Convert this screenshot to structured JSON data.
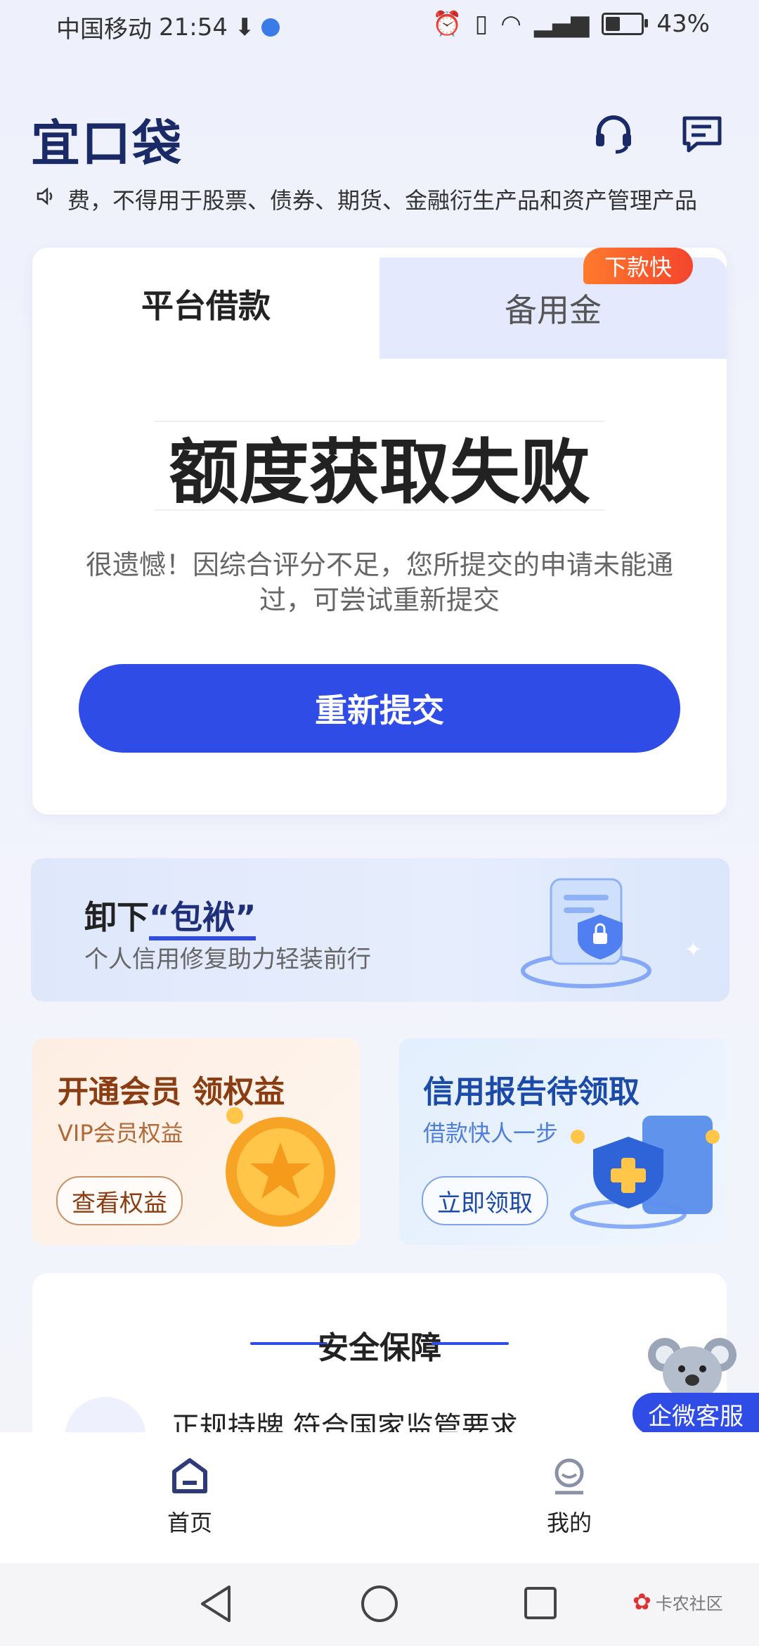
{
  "status_bar": {
    "carrier": "中国移动",
    "time": "21:54",
    "battery": "43%",
    "battery_level": 0.43
  },
  "header": {
    "logo": "宜口袋",
    "icons": [
      "headset-icon",
      "message-icon"
    ]
  },
  "marquee": {
    "icon": "speaker-icon",
    "text": "费，不得用于股票、债券、期货、金融衍生产品和资产管理产品"
  },
  "loan_card": {
    "tabs": [
      {
        "label": "平台借款",
        "active": true
      },
      {
        "label": "备用金",
        "active": false
      }
    ],
    "badge": "下款快",
    "status_title": "额度获取失败",
    "status_desc": "很遗憾！因综合评分不足，您所提交的申请未能通过，可尝试重新提交",
    "resubmit_label": "重新提交"
  },
  "banner": {
    "title_prefix": "卸下",
    "title_highlight": "“包袱”",
    "subtitle": "个人信用修复助力轻装前行"
  },
  "promos": [
    {
      "title": "开通会员 领权益",
      "subtitle": "VIP会员权益",
      "button": "查看权益"
    },
    {
      "title": "信用报告待领取",
      "subtitle": "借款快人一步",
      "button": "立即领取"
    }
  ],
  "security": {
    "title": "安全保障",
    "item": "正规持牌 符合国家监管要求"
  },
  "float_service": "企微客服",
  "bottom_nav": [
    {
      "label": "首页",
      "icon": "home-icon",
      "active": true
    },
    {
      "label": "我的",
      "icon": "profile-icon",
      "active": false
    }
  ],
  "watermark": "卡农社区",
  "colors": {
    "primary": "#2f4de6",
    "badge": "#f4452d",
    "promo_left_text": "#8a3d12",
    "promo_right_text": "#1b4aa8"
  }
}
